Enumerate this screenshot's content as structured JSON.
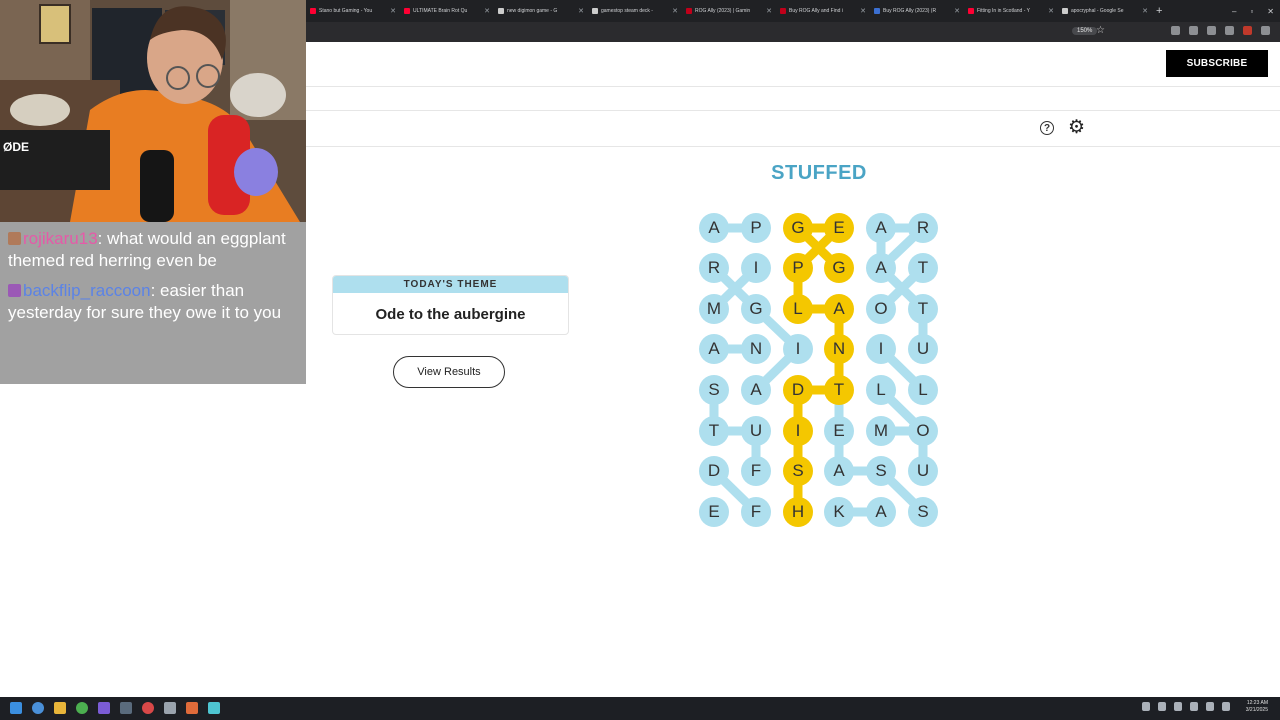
{
  "browser": {
    "tabs": [
      {
        "title": "Stano but Gaming - You",
        "color": "#ff0033"
      },
      {
        "title": "ULTIMATE Brain Rot Qu",
        "color": "#ff0033"
      },
      {
        "title": "new digimon game - G",
        "color": "#cccccc"
      },
      {
        "title": "gamestop steam deck -",
        "color": "#cccccc"
      },
      {
        "title": "ROG Ally (2023) | Gamin",
        "color": "#c0001a"
      },
      {
        "title": "Buy ROG Ally and Find i",
        "color": "#c0001a"
      },
      {
        "title": "Buy ROG Ally (2023) (R",
        "color": "#3b6fd1"
      },
      {
        "title": "Fitting In in Scotland - Y",
        "color": "#ff0033"
      },
      {
        "title": "apocryphal - Google Se",
        "color": "#cccccc"
      }
    ],
    "new_tab": "+",
    "zoom": "150%",
    "window_controls": [
      "–",
      "▫",
      "✕"
    ]
  },
  "chat": [
    {
      "user": "rojikaru13",
      "text": ": what would an eggplant themed red herring even be",
      "color": "#e55aa8",
      "badge_color": "#b07a5a"
    },
    {
      "user": "backflip_raccoon",
      "text": ": easier than yesterday for sure they owe it to you",
      "color": "#5b83e6",
      "badge_color": "#9b59b6"
    }
  ],
  "page": {
    "subscribe": "SUBSCRIBE",
    "help_icon": "?",
    "settings_icon": "⚙",
    "title": "STUFFED",
    "theme_header": "TODAY'S THEME",
    "theme": "Ode to the aubergine",
    "view_results": "View Results"
  },
  "board": {
    "rows": [
      [
        "A",
        "P",
        "G",
        "E",
        "A",
        "R"
      ],
      [
        "R",
        "I",
        "P",
        "G",
        "A",
        "T"
      ],
      [
        "M",
        "G",
        "L",
        "A",
        "O",
        "T"
      ],
      [
        "A",
        "N",
        "I",
        "N",
        "I",
        "U"
      ],
      [
        "S",
        "A",
        "D",
        "T",
        "L",
        "L"
      ],
      [
        "T",
        "U",
        "I",
        "E",
        "M",
        "O"
      ],
      [
        "D",
        "F",
        "S",
        "A",
        "S",
        "U"
      ],
      [
        "E",
        "F",
        "H",
        "K",
        "A",
        "S"
      ]
    ],
    "spangram_cells": [
      [
        0,
        2
      ],
      [
        0,
        3
      ],
      [
        1,
        2
      ],
      [
        1,
        3
      ],
      [
        2,
        2
      ],
      [
        2,
        3
      ],
      [
        3,
        3
      ],
      [
        4,
        2
      ],
      [
        4,
        3
      ],
      [
        5,
        2
      ],
      [
        6,
        2
      ],
      [
        7,
        2
      ]
    ],
    "theme_color": "#aedfee",
    "spangram_color": "#f4c700"
  },
  "taskbar": {
    "clock_time": "12:23 AM",
    "clock_date": "3/21/2025"
  }
}
